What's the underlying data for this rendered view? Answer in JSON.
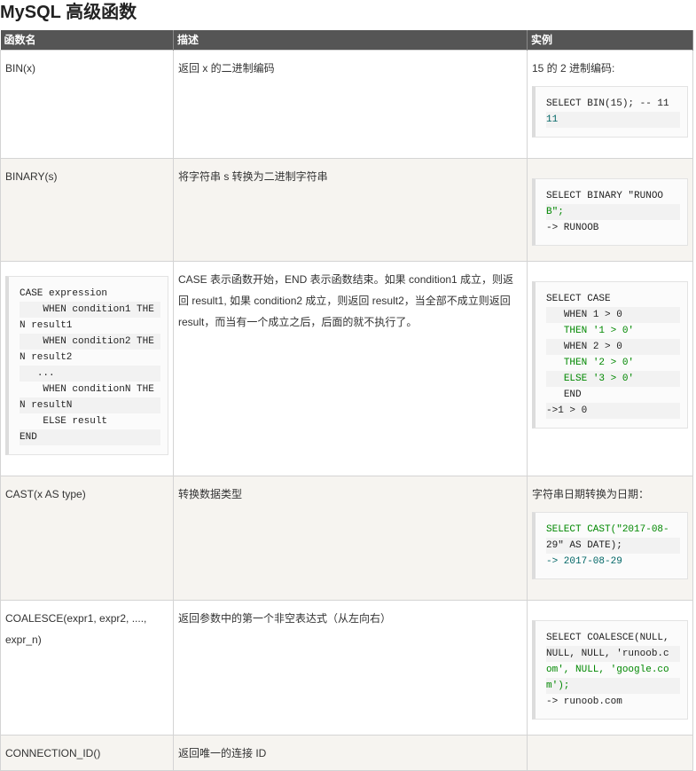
{
  "page": {
    "title": "MySQL 高级函数"
  },
  "table": {
    "headers": [
      "函数名",
      "描述",
      "实例"
    ],
    "rows": [
      {
        "name": "BIN(x)",
        "desc": "返回 x 的二进制编码",
        "example_intro": "15 的 2 进制编码:",
        "code_lines": [
          "SELECT BIN(15); -- 11",
          "11"
        ]
      },
      {
        "name": "BINARY(s)",
        "desc": "将字符串 s 转换为二进制字符串",
        "example_intro": "",
        "code_lines": [
          "SELECT BINARY \"RUNOO",
          "B\";",
          "-> RUNOOB"
        ]
      },
      {
        "name_code_lines": [
          "CASE expression",
          "    WHEN condition1 THE",
          "N result1",
          "    WHEN condition2 THE",
          "N result2",
          "   ...",
          "    WHEN conditionN THE",
          "N resultN",
          "    ELSE result",
          "END"
        ],
        "desc": "CASE 表示函数开始，END 表示函数结束。如果 condition1 成立，则返回 result1, 如果 condition2 成立，则返回 result2，当全部不成立则返回 result，而当有一个成立之后，后面的就不执行了。",
        "example_intro": "",
        "code_lines": [
          "SELECT CASE",
          "   WHEN 1 > 0",
          "   THEN '1 > 0'",
          "   WHEN 2 > 0",
          "   THEN '2 > 0'",
          "   ELSE '3 > 0'",
          "   END",
          "->1 > 0"
        ]
      },
      {
        "name": "CAST(x AS type)",
        "desc": "转换数据类型",
        "example_intro": "字符串日期转换为日期：",
        "code_lines": [
          "SELECT CAST(\"2017-08-",
          "29\" AS DATE);",
          "-> 2017-08-29"
        ]
      },
      {
        "name": "COALESCE(expr1, expr2, ...., expr_n)",
        "desc": "返回参数中的第一个非空表达式（从左向右）",
        "example_intro": "",
        "code_lines": [
          "SELECT COALESCE(NULL,",
          "NULL, NULL, 'runoob.c",
          "om', NULL, 'google.co",
          "m');",
          "-> runoob.com"
        ]
      },
      {
        "name": "CONNECTION_ID()",
        "desc": "返回唯一的连接 ID",
        "example_intro": "",
        "code_lines": []
      }
    ]
  }
}
